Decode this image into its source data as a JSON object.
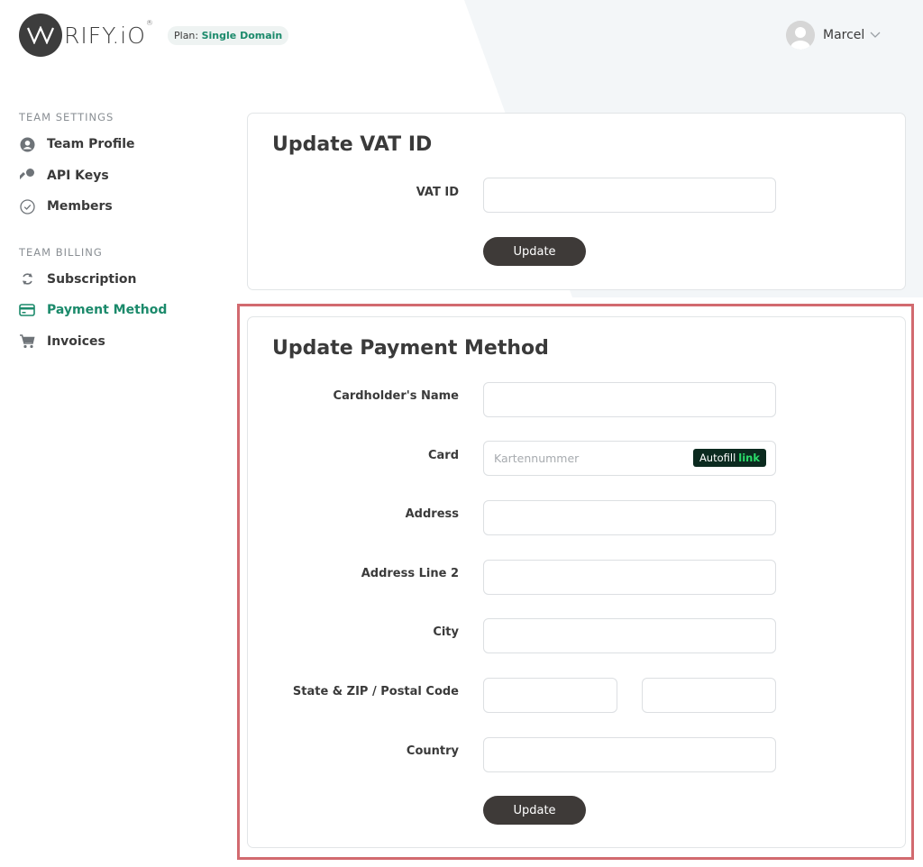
{
  "header": {
    "logo_text": "VARIFY.IO",
    "plan_label": "Plan:",
    "plan_value": "Single Domain",
    "user_name": "Marcel"
  },
  "sidebar": {
    "team_settings_heading": "TEAM SETTINGS",
    "team_settings_items": [
      {
        "label": "Team Profile",
        "icon": "user-circle-icon"
      },
      {
        "label": "API Keys",
        "icon": "key-icon"
      },
      {
        "label": "Members",
        "icon": "check-circle-icon"
      }
    ],
    "team_billing_heading": "TEAM BILLING",
    "team_billing_items": [
      {
        "label": "Subscription",
        "icon": "refresh-icon"
      },
      {
        "label": "Payment Method",
        "icon": "credit-card-icon",
        "active": true
      },
      {
        "label": "Invoices",
        "icon": "cart-icon"
      }
    ]
  },
  "vat_card": {
    "title": "Update VAT ID",
    "vat_label": "VAT ID",
    "vat_value": "",
    "button": "Update"
  },
  "payment_card": {
    "title": "Update Payment Method",
    "fields": {
      "cardholder_label": "Cardholder's Name",
      "card_label": "Card",
      "card_placeholder": "Kartennummer",
      "autofill_text": "Autofill",
      "autofill_link": "link",
      "address_label": "Address",
      "address2_label": "Address Line 2",
      "city_label": "City",
      "state_zip_label": "State & ZIP / Postal Code",
      "country_label": "Country"
    },
    "button": "Update"
  },
  "colors": {
    "accent": "#1b8a6b",
    "button": "#3e3a38",
    "highlight": "#d26a6f"
  }
}
